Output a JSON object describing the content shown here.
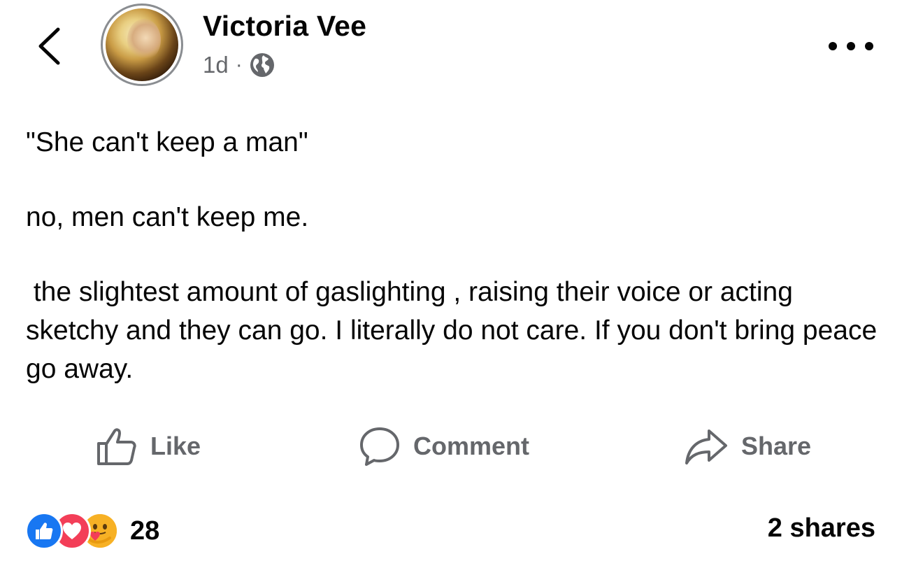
{
  "header": {
    "author_name": "Victoria Vee",
    "timestamp": "1d",
    "separator": "·",
    "audience_icon": "globe-icon",
    "back_icon": "chevron-left-icon",
    "more_icon": "more-horizontal-icon"
  },
  "post": {
    "paragraphs": [
      "\"She can't keep a man\"",
      "no, men can't keep me.",
      " the slightest amount of gaslighting , raising their voice or acting sketchy and they can go. I literally do not care. If you don't bring peace go away."
    ]
  },
  "actions": {
    "like_label": "Like",
    "comment_label": "Comment",
    "share_label": "Share"
  },
  "footer": {
    "reactions": [
      "like-reaction-icon",
      "love-reaction-icon",
      "care-reaction-icon"
    ],
    "reaction_count": "28",
    "shares_text": "2 shares"
  },
  "colors": {
    "text_primary": "#050505",
    "text_secondary": "#65676b",
    "like_blue": "#1877f2",
    "love_red": "#f33e58",
    "care_yellow": "#f7b125"
  }
}
